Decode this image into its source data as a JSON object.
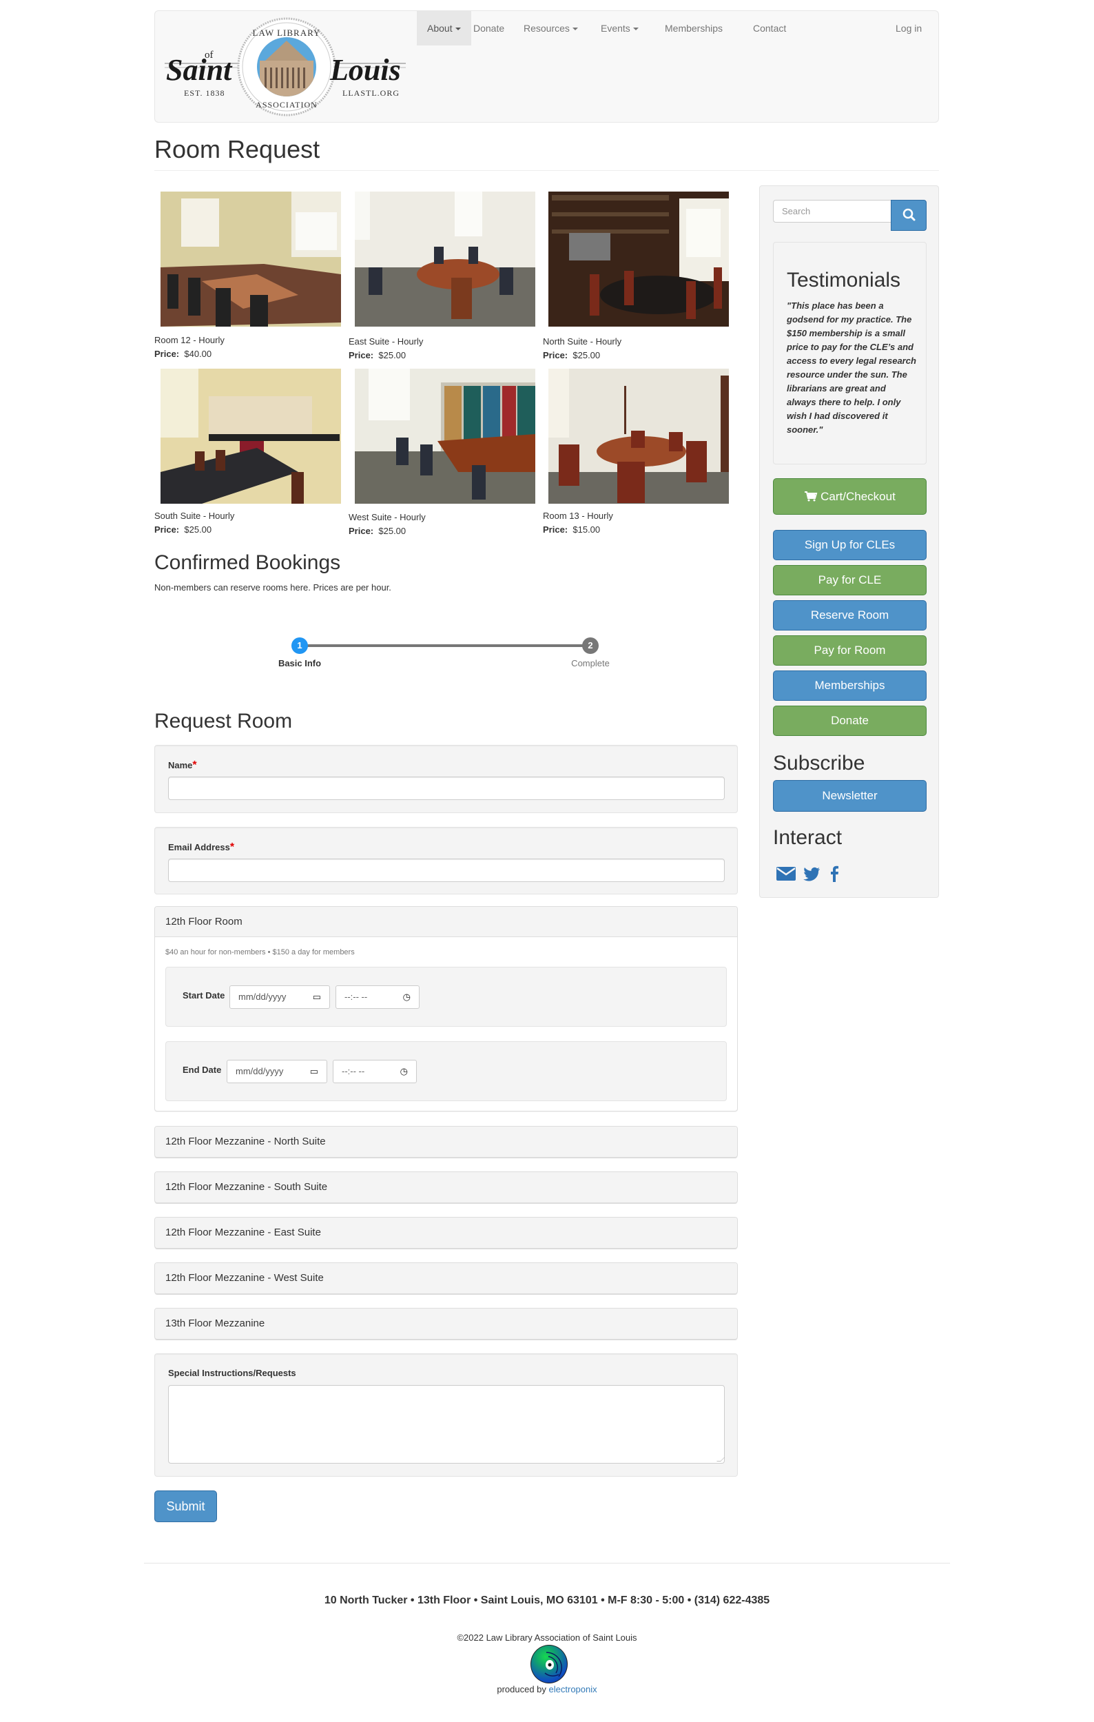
{
  "nav": {
    "logo": {
      "left_script": "Saint",
      "of": "of",
      "est": "EST. 1838",
      "right_script": "Louis",
      "url": "LLASTL.ORG",
      "ring_top": "LAW LIBRARY",
      "ring_bottom": "ASSOCIATION"
    },
    "items": [
      {
        "label": "About",
        "dropdown": true,
        "active": true
      },
      {
        "label": "Donate",
        "dropdown": false
      },
      {
        "label": "Resources",
        "dropdown": true
      },
      {
        "label": "Events",
        "dropdown": true
      },
      {
        "label": "Memberships",
        "dropdown": false
      },
      {
        "label": "Contact",
        "dropdown": false
      }
    ],
    "login": "Log in"
  },
  "page": {
    "title": "Room Request"
  },
  "rooms": [
    {
      "name": "Room 12 - Hourly",
      "price_label": "Price:",
      "price": "$40.00"
    },
    {
      "name": "East Suite - Hourly",
      "price_label": "Price:",
      "price": "$25.00"
    },
    {
      "name": "North Suite - Hourly",
      "price_label": "Price:",
      "price": "$25.00"
    },
    {
      "name": "South Suite - Hourly",
      "price_label": "Price:",
      "price": "$25.00"
    },
    {
      "name": "West Suite - Hourly",
      "price_label": "Price:",
      "price": "$25.00"
    },
    {
      "name": "Room 13 - Hourly",
      "price_label": "Price:",
      "price": "$15.00"
    }
  ],
  "bookings": {
    "title": "Confirmed Bookings",
    "intro": "Non-members can reserve rooms here. Prices are per hour."
  },
  "steps": [
    {
      "number": "1",
      "label": "Basic Info",
      "active": true
    },
    {
      "number": "2",
      "label": "Complete",
      "active": false
    }
  ],
  "form": {
    "title": "Request Room",
    "name_label": "Name",
    "name_value": "",
    "email_label": "Email Address",
    "email_value": "",
    "required_mark": "*",
    "room_panel": {
      "title": "12th Floor Room",
      "note": "$40 an hour for non-members • $150 a day for members",
      "start_label": "Start Date",
      "end_label": "End Date",
      "date_placeholder": "mm/dd/yyyy",
      "time_placeholder": "--:-- --"
    },
    "collapsed_panels": [
      "12th Floor Mezzanine - North Suite",
      "12th Floor Mezzanine - South Suite",
      "12th Floor Mezzanine - East Suite",
      "12th Floor Mezzanine - West Suite",
      "13th Floor Mezzanine"
    ],
    "instructions_label": "Special Instructions/Requests",
    "instructions_value": "",
    "submit": "Submit"
  },
  "sidebar": {
    "search_placeholder": "Search",
    "testimonials_title": "Testimonials",
    "testimonial": "\"This place has been a godsend for my practice. The $150 membership is a small price to pay for the CLE’s and access to every legal research resource under the sun. The librarians are great and always there to help.  I only wish I had discovered it sooner.\"",
    "cart": "Cart/Checkout",
    "buttons": [
      {
        "label": "Sign Up for CLEs",
        "style": "blue"
      },
      {
        "label": "Pay for CLE",
        "style": "green"
      },
      {
        "label": "Reserve Room",
        "style": "blue"
      },
      {
        "label": "Pay for Room",
        "style": "green"
      },
      {
        "label": "Memberships",
        "style": "blue"
      },
      {
        "label": "Donate",
        "style": "green"
      }
    ],
    "subscribe_title": "Subscribe",
    "newsletter": "Newsletter",
    "interact_title": "Interact",
    "social": [
      "envelope-icon",
      "twitter-icon",
      "facebook-icon"
    ]
  },
  "colors": {
    "primary": "#4f93c9",
    "success": "#79ac5f",
    "step_active": "#2196f3",
    "step_inactive": "#777777",
    "required": "#e00000",
    "link": "#337ab7"
  },
  "footer": {
    "address": "10 North Tucker • 13th Floor • Saint Louis, MO 63101 • M-F 8:30 - 5:00 • (314) 622-4385",
    "copyright": "©2022 Law Library Association of Saint Louis",
    "produced_by": "produced by",
    "producer": "electroponix"
  }
}
